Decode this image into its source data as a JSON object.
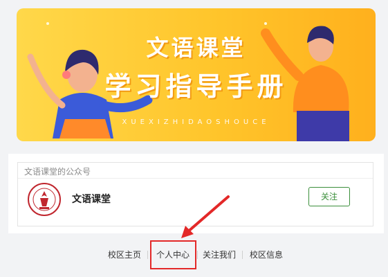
{
  "banner": {
    "title_line1": "文语课堂",
    "title_line2": "学习指导手册",
    "subtitle": "XUEXIZHIDAOSHOUCE"
  },
  "account_card": {
    "header": "文语课堂的公众号",
    "name": "文语课堂",
    "follow_label": "关注",
    "logo_icon": "school-seal-logo"
  },
  "nav": {
    "items": [
      "校区主页",
      "个人中心",
      "关注我们",
      "校区信息"
    ],
    "highlighted": "个人中心"
  },
  "colors": {
    "banner_yellow": "#ffc52b",
    "follow_green": "#3a8e3a",
    "annotation_red": "#e32828",
    "page_bg": "#f2f3f5"
  }
}
